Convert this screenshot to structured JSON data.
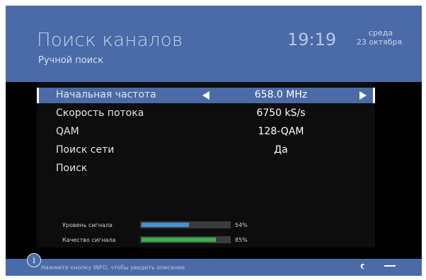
{
  "header": {
    "title": "Поиск каналов",
    "subtitle": "Ручной поиск",
    "time": "19:19",
    "weekday": "среда",
    "date": "23 октября"
  },
  "settings": [
    {
      "label": "Начальная частота",
      "value": "658.0 MHz",
      "selected": true
    },
    {
      "label": "Скорость потока",
      "value": "6750 kS/s"
    },
    {
      "label": "QAM",
      "value": "128-QAM"
    },
    {
      "label": "Поиск сети",
      "value": "Да"
    },
    {
      "label": "Поиск",
      "value": ""
    }
  ],
  "signal": {
    "level_label": "Уровень сигнала",
    "level_percent": 54,
    "level_text": "54%",
    "quality_label": "Качество сигнала",
    "quality_percent": 85,
    "quality_text": "85%"
  },
  "footer": {
    "hint": "Нажмите кнопку INFO, чтобы увидеть описание",
    "info_glyph": "i"
  },
  "colors": {
    "accent": "#4a6aa8",
    "level_bar": "#4a90d6",
    "quality_bar": "#3cb04a"
  }
}
